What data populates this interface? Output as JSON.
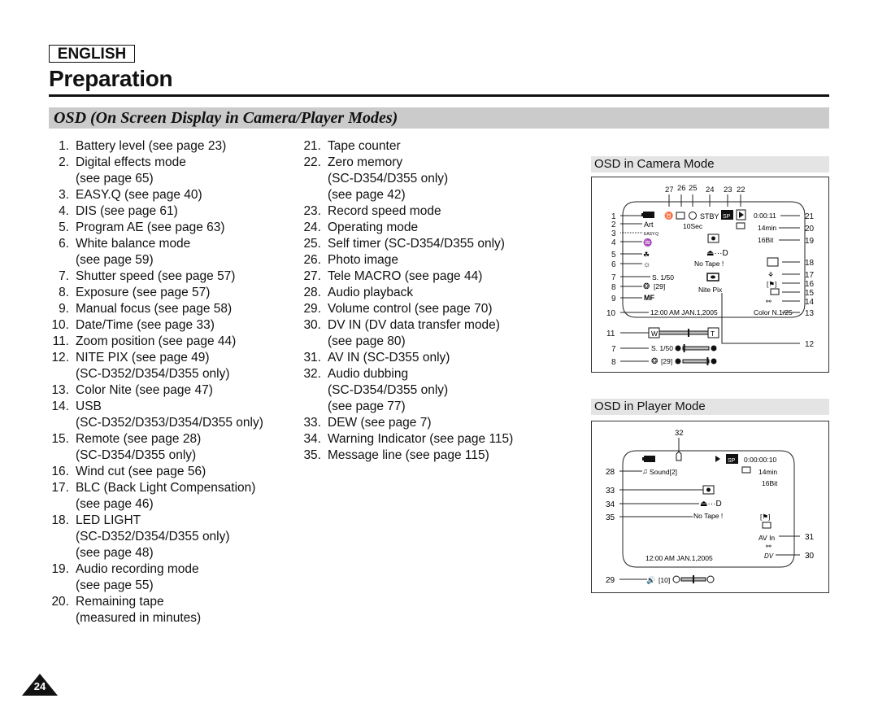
{
  "header": {
    "language": "ENGLISH",
    "title": "Preparation",
    "section_title": "OSD (On Screen Display in Camera/Player Modes)"
  },
  "list_left": [
    {
      "n": "1.",
      "text": "Battery level (see page 23)"
    },
    {
      "n": "2.",
      "text": "Digital effects mode\n(see page 65)"
    },
    {
      "n": "3.",
      "text": "EASY.Q (see page 40)"
    },
    {
      "n": "4.",
      "text": "DIS (see page 61)"
    },
    {
      "n": "5.",
      "text": "Program AE (see page 63)"
    },
    {
      "n": "6.",
      "text": "White balance mode\n(see page 59)"
    },
    {
      "n": "7.",
      "text": "Shutter speed (see page 57)"
    },
    {
      "n": "8.",
      "text": "Exposure (see page 57)"
    },
    {
      "n": "9.",
      "text": "Manual focus (see page 58)"
    },
    {
      "n": "10.",
      "text": "Date/Time (see page 33)"
    },
    {
      "n": "11.",
      "text": "Zoom position (see page 44)"
    },
    {
      "n": "12.",
      "text": "NITE PIX (see page 49)\n(SC-D352/D354/D355 only)"
    },
    {
      "n": "13.",
      "text": "Color Nite (see page 47)"
    },
    {
      "n": "14.",
      "text": "USB\n(SC-D352/D353/D354/D355 only)"
    },
    {
      "n": "15.",
      "text": "Remote (see page 28)\n(SC-D354/D355 only)"
    },
    {
      "n": "16.",
      "text": "Wind cut (see page 56)"
    },
    {
      "n": "17.",
      "text": "BLC (Back Light Compensation)\n(see page 46)"
    },
    {
      "n": "18.",
      "text": "LED LIGHT\n(SC-D352/D354/D355 only)\n(see page 48)"
    },
    {
      "n": "19.",
      "text": "Audio recording mode\n(see page 55)"
    },
    {
      "n": "20.",
      "text": "Remaining tape\n(measured in minutes)"
    }
  ],
  "list_right": [
    {
      "n": "21.",
      "text": "Tape counter"
    },
    {
      "n": "22.",
      "text": "Zero memory\n(SC-D354/D355 only)\n(see page 42)"
    },
    {
      "n": "23.",
      "text": "Record speed mode"
    },
    {
      "n": "24.",
      "text": "Operating mode"
    },
    {
      "n": "25.",
      "text": "Self timer (SC-D354/D355 only)"
    },
    {
      "n": "26.",
      "text": "Photo image"
    },
    {
      "n": "27.",
      "text": "Tele MACRO (see page 44)"
    },
    {
      "n": "28.",
      "text": "Audio playback"
    },
    {
      "n": "29.",
      "text": "Volume control (see page 70)"
    },
    {
      "n": "30.",
      "text": "DV IN (DV data transfer mode)\n(see page 80)"
    },
    {
      "n": "31.",
      "text": "AV IN (SC-D355 only)"
    },
    {
      "n": "32.",
      "text": "Audio dubbing\n(SC-D354/D355 only)\n(see page 77)"
    },
    {
      "n": "33.",
      "text": "DEW (see page 7)"
    },
    {
      "n": "34.",
      "text": "Warning Indicator (see page 115)"
    },
    {
      "n": "35.",
      "text": "Message line (see page 115)"
    }
  ],
  "camera_osd": {
    "title": "OSD in Camera Mode",
    "top_callouts": [
      "27",
      "26",
      "25",
      "24",
      "23",
      "22"
    ],
    "left_callouts": [
      "1",
      "2",
      "3",
      "4",
      "5",
      "6",
      "7",
      "8",
      "9",
      "10",
      "11",
      "7",
      "8"
    ],
    "right_callouts": [
      "21",
      "20",
      "19",
      "18",
      "17",
      "16",
      "15",
      "14",
      "13",
      "12"
    ],
    "effect": "Art",
    "easyq": "EASY.Q",
    "status": "STBY",
    "speed": "SP",
    "self_timer": "10Sec",
    "counter": "0:00:11",
    "remaining": "14min",
    "audio_mode": "16Bit",
    "warning": "⏏···D",
    "message": "No Tape !",
    "shutter": "S. 1/50",
    "exposure": "[29]",
    "focus": "MF",
    "nite_pix": "Nite Pix",
    "datetime": "12:00 AM JAN.1,2005",
    "color_nite": "Color N.1/25",
    "zoom_w": "W",
    "zoom_t": "T",
    "zoom_level": 0.6,
    "shutter_level": 0.05,
    "exposure_level": 0.95
  },
  "player_osd": {
    "title": "OSD in Player Mode",
    "top_callout": "32",
    "left_callouts": [
      "28",
      "33",
      "34",
      "35",
      "29"
    ],
    "right_callouts": [
      "31",
      "30"
    ],
    "sound": "Sound[2]",
    "speed": "SP",
    "counter": "0:00:00:10",
    "remaining": "14min",
    "audio_mode": "16Bit",
    "warning": "⏏···D",
    "message": "No Tape !",
    "av_in": "AV In",
    "dv_in": "DV",
    "datetime": "12:00 AM JAN.1,2005",
    "volume": "[10]",
    "volume_level": 0.5
  },
  "footer": {
    "page_number": "24"
  }
}
